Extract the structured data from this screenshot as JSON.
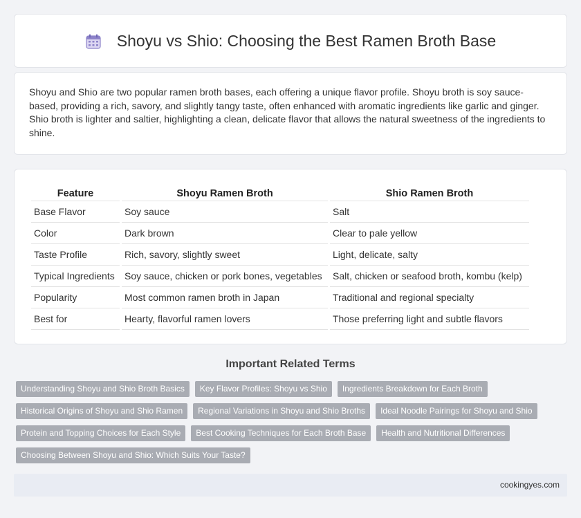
{
  "header": {
    "title": "Shoyu vs Shio: Choosing the Best Ramen Broth Base",
    "icon": "calendar-icon"
  },
  "intro": {
    "text": "Shoyu and Shio are two popular ramen broth bases, each offering a unique flavor profile. Shoyu broth is soy sauce-based, providing a rich, savory, and slightly tangy taste, often enhanced with aromatic ingredients like garlic and ginger. Shio broth is lighter and saltier, highlighting a clean, delicate flavor that allows the natural sweetness of the ingredients to shine."
  },
  "table": {
    "headers": [
      "Feature",
      "Shoyu Ramen Broth",
      "Shio Ramen Broth"
    ],
    "rows": [
      [
        "Base Flavor",
        "Soy sauce",
        "Salt"
      ],
      [
        "Color",
        "Dark brown",
        "Clear to pale yellow"
      ],
      [
        "Taste Profile",
        "Rich, savory, slightly sweet",
        "Light, delicate, salty"
      ],
      [
        "Typical Ingredients",
        "Soy sauce, chicken or pork bones, vegetables",
        "Salt, chicken or seafood broth, kombu (kelp)"
      ],
      [
        "Popularity",
        "Most common ramen broth in Japan",
        "Traditional and regional specialty"
      ],
      [
        "Best for",
        "Hearty, flavorful ramen lovers",
        "Those preferring light and subtle flavors"
      ]
    ]
  },
  "related": {
    "title": "Important Related Terms",
    "rows": [
      [
        "Understanding Shoyu and Shio Broth Basics",
        "Key Flavor Profiles: Shoyu vs Shio",
        "Ingredients Breakdown for Each Broth"
      ],
      [
        "Historical Origins of Shoyu and Shio Ramen",
        "Regional Variations in Shoyu and Shio Broths",
        "Ideal Noodle Pairings for Shoyu and Shio"
      ],
      [
        "Protein and Topping Choices for Each Style",
        "Best Cooking Techniques for Each Broth Base",
        "Health and Nutritional Differences"
      ],
      [
        "Choosing Between Shoyu and Shio: Which Suits Your Taste?"
      ]
    ]
  },
  "footer": {
    "site": "cookingyes.com"
  }
}
